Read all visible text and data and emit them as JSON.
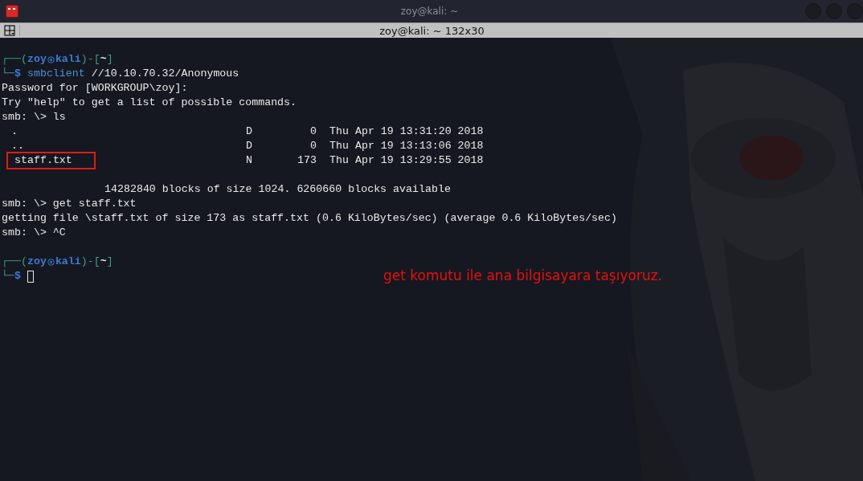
{
  "window": {
    "title": "zoy@kali: ~"
  },
  "terminal": {
    "title": "zoy@kali: ~ 132x30",
    "lines": [
      {
        "kind": "blank"
      },
      {
        "kind": "prompt",
        "frame_open": "┌──(",
        "user": "zoy",
        "host": "kali",
        "frame_mid": ")-[",
        "dir": "~",
        "frame_close": "]",
        "corner": "└─",
        "sign": "$",
        "command": "smbclient",
        "args": "//10.10.70.32/Anonymous"
      },
      {
        "kind": "text",
        "text": "Password for [WORKGROUP\\zoy]:"
      },
      {
        "kind": "text",
        "text": "Try \"help\" to get a list of possible commands."
      },
      {
        "kind": "text",
        "text": "smb: \\> ls"
      },
      {
        "kind": "listing",
        "name": ".",
        "type": "D",
        "size": "0",
        "date": "Thu Apr 19 13:31:20 2018",
        "highlighted": false
      },
      {
        "kind": "listing",
        "name": "..",
        "type": "D",
        "size": "0",
        "date": "Thu Apr 19 13:13:06 2018",
        "highlighted": false
      },
      {
        "kind": "listing",
        "name": "staff.txt",
        "type": "N",
        "size": "173",
        "date": "Thu Apr 19 13:29:55 2018",
        "highlighted": true
      },
      {
        "kind": "blank"
      },
      {
        "kind": "summary",
        "text": "14282840 blocks of size 1024. 6260660 blocks available"
      },
      {
        "kind": "text",
        "text": "smb: \\> get staff.txt"
      },
      {
        "kind": "text",
        "text": "getting file \\staff.txt of size 173 as staff.txt (0.6 KiloBytes/sec) (average 0.6 KiloBytes/sec)"
      },
      {
        "kind": "text",
        "text": "smb: \\> ^C"
      },
      {
        "kind": "blank"
      },
      {
        "kind": "prompt",
        "frame_open": "┌──(",
        "user": "zoy",
        "host": "kali",
        "frame_mid": ")-[",
        "dir": "~",
        "frame_close": "]",
        "corner": "└─",
        "sign": "$",
        "cursor": true
      }
    ]
  },
  "annotation": {
    "text": "get komutu ile ana bilgisayara taşıyoruz."
  }
}
